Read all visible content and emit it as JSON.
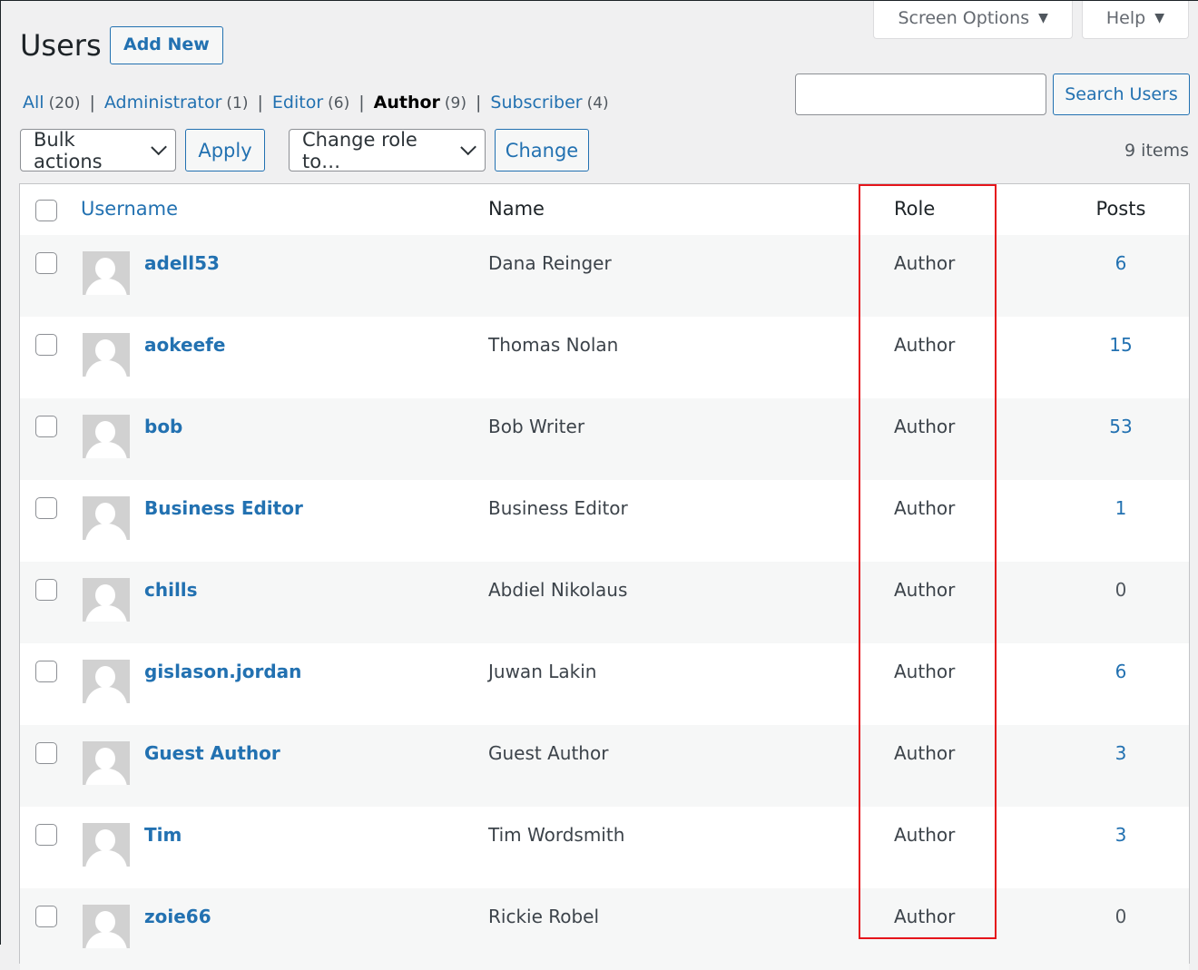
{
  "header": {
    "title": "Users",
    "add_new_label": "Add New",
    "screen_options_label": "Screen Options",
    "help_label": "Help"
  },
  "filters": [
    {
      "label": "All",
      "count": "(20)",
      "current": false
    },
    {
      "label": "Administrator",
      "count": "(1)",
      "current": false
    },
    {
      "label": "Editor",
      "count": "(6)",
      "current": false
    },
    {
      "label": "Author",
      "count": "(9)",
      "current": true
    },
    {
      "label": "Subscriber",
      "count": "(4)",
      "current": false
    }
  ],
  "search": {
    "value": "",
    "button_label": "Search Users"
  },
  "toolbar": {
    "bulk_actions_label": "Bulk actions",
    "apply_label": "Apply",
    "change_role_label": "Change role to…",
    "change_label": "Change",
    "items_count": "9 items"
  },
  "table": {
    "columns": {
      "username": "Username",
      "name": "Name",
      "role": "Role",
      "posts": "Posts"
    },
    "rows": [
      {
        "username": "adell53",
        "name": "Dana Reinger",
        "role": "Author",
        "posts": "6"
      },
      {
        "username": "aokeefe",
        "name": "Thomas Nolan",
        "role": "Author",
        "posts": "15"
      },
      {
        "username": "bob",
        "name": "Bob Writer",
        "role": "Author",
        "posts": "53"
      },
      {
        "username": "Business Editor",
        "name": "Business Editor",
        "role": "Author",
        "posts": "1"
      },
      {
        "username": "chills",
        "name": "Abdiel Nikolaus",
        "role": "Author",
        "posts": "0"
      },
      {
        "username": "gislason.jordan",
        "name": "Juwan Lakin",
        "role": "Author",
        "posts": "6"
      },
      {
        "username": "Guest Author",
        "name": "Guest Author",
        "role": "Author",
        "posts": "3"
      },
      {
        "username": "Tim",
        "name": "Tim Wordsmith",
        "role": "Author",
        "posts": "3"
      },
      {
        "username": "zoie66",
        "name": "Rickie Robel",
        "role": "Author",
        "posts": "0"
      }
    ]
  },
  "colors": {
    "link": "#2271b1",
    "highlight": "#e5141b",
    "background": "#f0f0f1"
  }
}
